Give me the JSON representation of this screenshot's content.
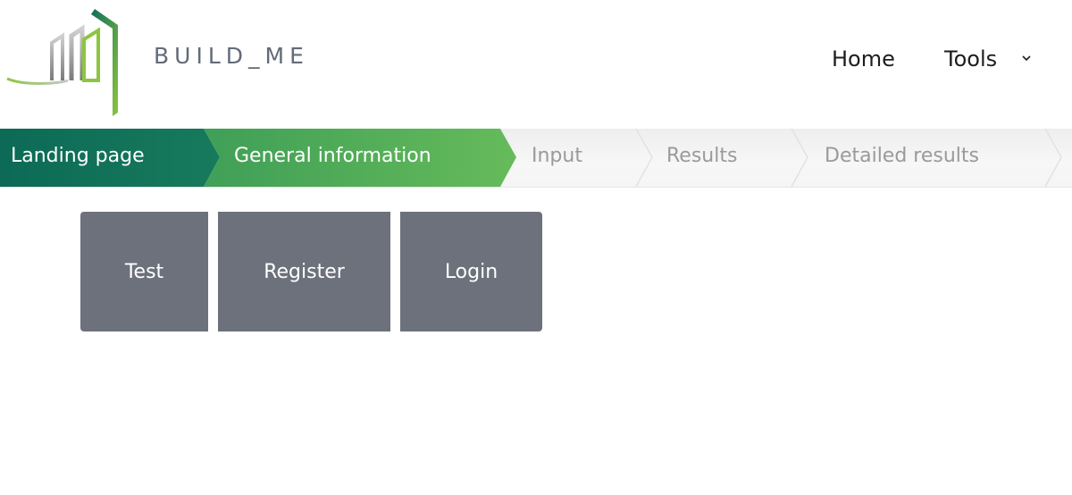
{
  "header": {
    "brand": "BUILD_ME",
    "nav": {
      "home_label": "Home",
      "tools_label": "Tools"
    }
  },
  "steps": {
    "items": [
      {
        "label": "Landing page",
        "state": "active"
      },
      {
        "label": "General information",
        "state": "active"
      },
      {
        "label": "Input",
        "state": "inactive"
      },
      {
        "label": "Results",
        "state": "inactive"
      },
      {
        "label": "Detailed results",
        "state": "inactive"
      }
    ]
  },
  "main": {
    "buttons": [
      {
        "label": "Test"
      },
      {
        "label": "Register"
      },
      {
        "label": "Login"
      }
    ]
  },
  "colors": {
    "step_dark_green": "#0f6e5a",
    "step_light_green": "#56b45a",
    "button_gray": "#6c717b",
    "brand_text": "#636b78"
  }
}
